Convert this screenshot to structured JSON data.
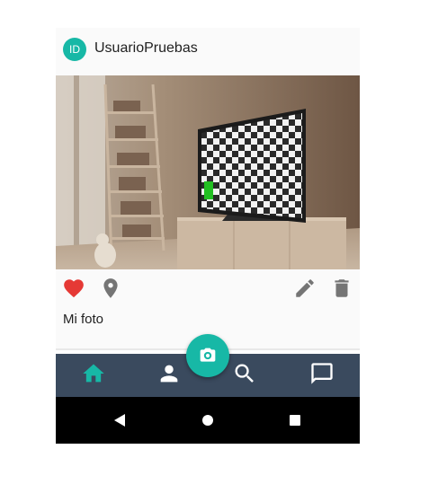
{
  "post": {
    "avatar_initials": "ID",
    "username": "UsuarioPruebas",
    "photo_description": "Room with TV showing checkerboard pattern",
    "caption": "Mi foto",
    "liked": true
  },
  "icons": {
    "like": "heart-icon",
    "location": "location-pin-icon",
    "edit": "pencil-icon",
    "delete": "trash-icon",
    "camera": "camera-icon",
    "home": "home-icon",
    "profile": "person-icon",
    "search": "search-icon",
    "messages": "chat-icon",
    "back": "back-triangle-icon",
    "home_sys": "home-circle-icon",
    "recents": "recents-square-icon"
  },
  "colors": {
    "accent": "#17b8a6",
    "like": "#e53935",
    "nav_bg": "#3a4a5e",
    "nav_active": "#17b8a6",
    "nav_icon": "#ffffff",
    "action_icon": "#757575"
  }
}
